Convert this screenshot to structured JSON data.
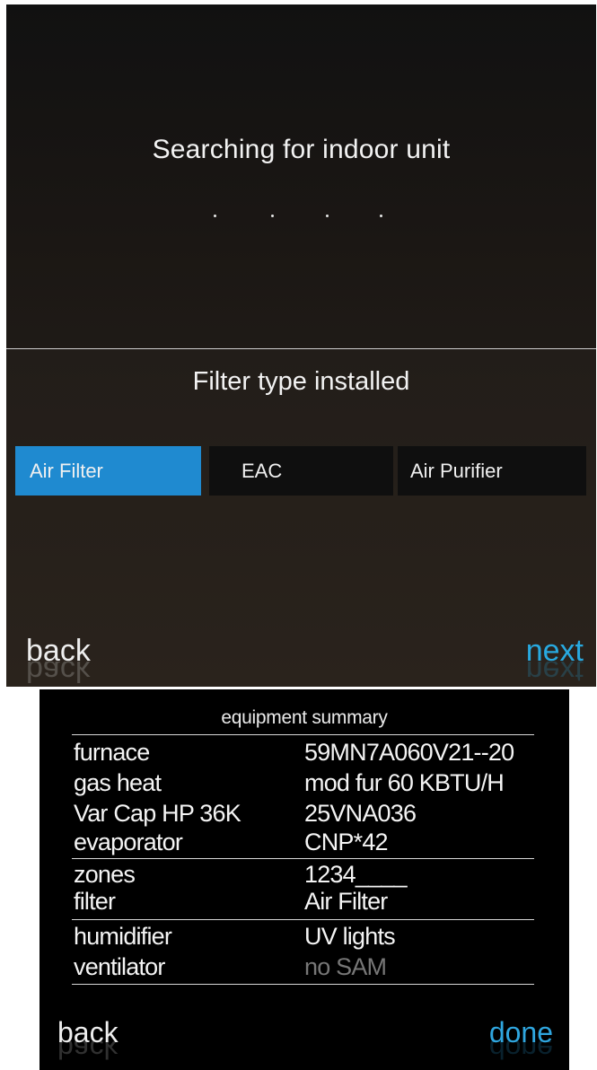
{
  "screen1": {
    "search_title": "Searching for indoor unit",
    "filter_title": "Filter type installed",
    "filter_options": [
      {
        "label": "Air Filter",
        "selected": true
      },
      {
        "label": "EAC",
        "selected": false
      },
      {
        "label": "Air Purifier",
        "selected": false
      }
    ],
    "back_label": "back",
    "next_label": "next",
    "colors": {
      "accent": "#1f8ad0",
      "next_text": "#28a9e0",
      "back_text": "#eeeeee"
    }
  },
  "screen2": {
    "title": "equipment summary",
    "rows": [
      {
        "label": "furnace",
        "value": "59MN7A060V21--20"
      },
      {
        "label": "gas heat",
        "value": "mod fur 60 KBTU/H"
      },
      {
        "label": "Var Cap HP 36K",
        "value": "25VNA036"
      },
      {
        "label": "evaporator",
        "value": "CNP*42"
      },
      {
        "label": "zones",
        "value": "1234____"
      },
      {
        "label": "filter",
        "value": "Air Filter"
      },
      {
        "label": "humidifier",
        "value": "UV lights"
      },
      {
        "label": "ventilator",
        "value": "no SAM"
      }
    ],
    "back_label": "back",
    "done_label": "done",
    "colors": {
      "done_text": "#2fa6df",
      "dim_value": "#777777"
    }
  }
}
